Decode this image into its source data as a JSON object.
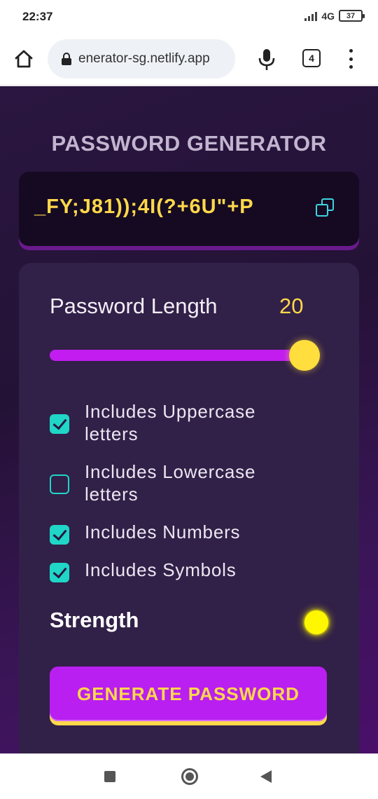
{
  "status_bar": {
    "time": "22:37",
    "network": "4G",
    "battery": "37",
    "icons": [
      "signal-icon",
      "battery-icon"
    ]
  },
  "browser": {
    "url": "enerator-sg.netlify.app",
    "tab_count": "4",
    "icons": [
      "home-icon",
      "lock-icon",
      "microphone-icon",
      "tabs-icon",
      "more-vert-icon"
    ]
  },
  "app": {
    "title": "PASSWORD GENERATOR",
    "password": "_FY;J81));4I(?+6U\"+P",
    "length_label": "Password Length",
    "length_value": "20",
    "slider_fraction": 1.0,
    "options": [
      {
        "label": "Includes Uppercase letters",
        "checked": true
      },
      {
        "label": "Includes Lowercase letters",
        "checked": false
      },
      {
        "label": "Includes Numbers",
        "checked": true
      },
      {
        "label": "Includes Symbols",
        "checked": true
      }
    ],
    "strength_label": "Strength",
    "strength_color": "#fff700",
    "generate_label": "GENERATE PASSWORD"
  },
  "colors": {
    "accent_purple": "#b81ff0",
    "accent_yellow": "#ffd84a",
    "checkbox_teal": "#1fd6c7"
  },
  "nav": {
    "icons": [
      "recents-icon",
      "home-circle-icon",
      "back-icon"
    ]
  }
}
